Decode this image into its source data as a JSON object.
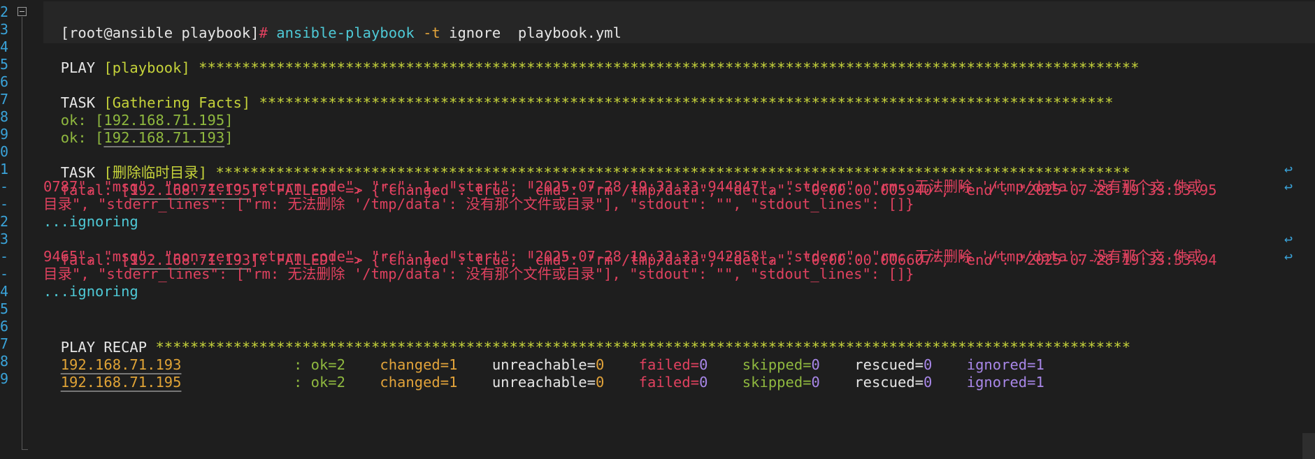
{
  "gutter": {
    "line_numbers": [
      "2",
      "3",
      "4",
      "5",
      "6",
      "7",
      "8",
      "9",
      "0",
      "1",
      "-",
      "-",
      "2",
      "3",
      "-",
      "-",
      "4",
      "5",
      "6",
      "7",
      "8",
      "9"
    ]
  },
  "prompt": {
    "user_host": "[root@ansible playbook]",
    "hash": "#",
    "command": "ansible-playbook",
    "flag": "-t",
    "arg": "ignore",
    "file": "playbook.yml"
  },
  "play": {
    "keyword": "PLAY",
    "name": "[playbook]",
    "stars": "*************************************************************************************************************"
  },
  "task1": {
    "keyword": "TASK",
    "name": "[Gathering Facts]",
    "stars": "***************************************************************************************************",
    "results": [
      {
        "prefix": "ok: [",
        "host": "192.168.71.195",
        "suffix": "]"
      },
      {
        "prefix": "ok: [",
        "host": "192.168.71.193",
        "suffix": "]"
      }
    ]
  },
  "task2": {
    "keyword": "TASK",
    "name": "[删除临时目录]",
    "stars": "**********************************************************************************************************",
    "fatal1": {
      "prefix": "fatal: [",
      "host": "192.168.71.195",
      "line1": "]: FAILED! => {\"changed\": true, \"cmd\": \"rm /tmp/data\", \"delta\": \"0:00:00.005940\", \"end\": \"2025-07-28 19:33:33.95",
      "line2": "0787\", \"msg\": \"non-zero return code\", \"rc\": 1, \"start\": \"2025-07-28 19:33:33.944847\", \"stderr\": \"rm: 无法删除 '/tmp/data': 没有那个文 件或",
      "line3": "目录\", \"stderr_lines\": [\"rm: 无法删除 '/tmp/data': 没有那个文件或目录\"], \"stdout\": \"\", \"stdout_lines\": []}"
    },
    "ignoring1": "...ignoring",
    "fatal2": {
      "prefix": "fatal: [",
      "host": "192.168.71.193",
      "line1": "]: FAILED! => {\"changed\": true, \"cmd\": \"rm /tmp/data\", \"delta\": \"0:00:00.006607\", \"end\": \"2025-07-28 19:33:33.94",
      "line2": "9465\", \"msg\": \"non-zero return code\", \"rc\": 1, \"start\": \"2025-07-28 19:33:33.942858\", \"stderr\": \"rm: 无法删除 '/tmp/data': 没有那个文 件或",
      "line3": "目录\", \"stderr_lines\": [\"rm: 无法删除 '/tmp/data': 没有那个文件或目录\"], \"stdout\": \"\", \"stdout_lines\": []}"
    },
    "ignoring2": "...ignoring"
  },
  "recap": {
    "title": "PLAY RECAP",
    "stars": "*****************************************************************************************************************",
    "rows": [
      {
        "host": "192.168.71.193",
        "ok": ": ok=2",
        "changed": "changed=1",
        "unreachable_label": "unreachable=",
        "unreachable_val": "0",
        "failed_label": "failed=",
        "failed_val": "0",
        "skipped_label": "skipped=",
        "skipped_val": "0",
        "rescued_label": "rescued=",
        "rescued_val": "0",
        "ignored": "ignored=1"
      },
      {
        "host": "192.168.71.195",
        "ok": ": ok=2",
        "changed": "changed=1",
        "unreachable_label": "unreachable=",
        "unreachable_val": "0",
        "failed_label": "failed=",
        "failed_val": "0",
        "skipped_label": "skipped=",
        "skipped_val": "0",
        "rescued_label": "rescued=",
        "rescued_val": "0",
        "ignored": "ignored=1"
      }
    ]
  },
  "wrap_glyph": "↩",
  "colors": {
    "background": "#1e1e1e",
    "line_number": "#3aa3d9",
    "stars": "#c5d23a",
    "ok": "#8fb83f",
    "command": "#4ec9d6",
    "fatal": "#e0415f",
    "ignored": "#a887e8",
    "host": "#e0a336"
  }
}
